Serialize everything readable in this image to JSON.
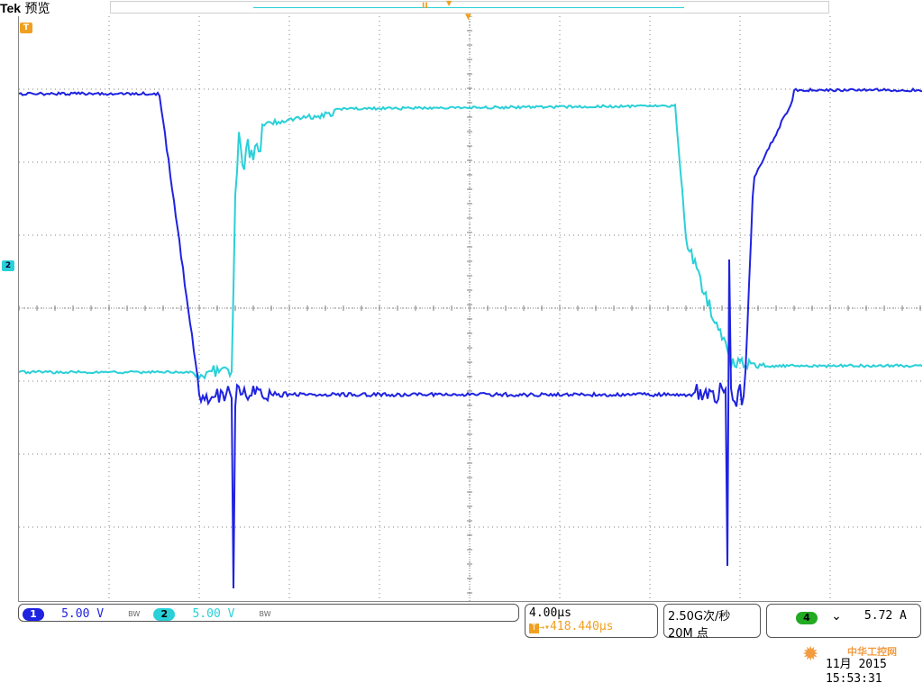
{
  "header": {
    "brand": "Tek",
    "mode": "预览",
    "trigger_marker_label": "T",
    "record_bar_marker": "II"
  },
  "channels": [
    {
      "id": "1",
      "scale": "5.00 V",
      "bw_flag": "BW",
      "color": "#1f23e0"
    },
    {
      "id": "2",
      "scale": "5.00 V",
      "bw_flag": "BW",
      "color": "#2ad0d8"
    }
  ],
  "ch2_marker": "2",
  "timebase": {
    "scale": "4.00µs",
    "trigger_delay": "418.440µs"
  },
  "acquisition": {
    "rate": "2.50G次/秒",
    "points": "20M 点"
  },
  "trigger": {
    "source": "4",
    "slope_symbol": "⌄",
    "level": "5.72 A"
  },
  "clock": {
    "date": "11月 2015",
    "time": "15:53:31"
  },
  "watermark": "中华工控网",
  "colors": {
    "ch1": "#1f23e0",
    "ch2": "#2ad0d8",
    "grid": "#808080",
    "trigger": "#f0a020",
    "ch4": "#22aa22"
  }
}
